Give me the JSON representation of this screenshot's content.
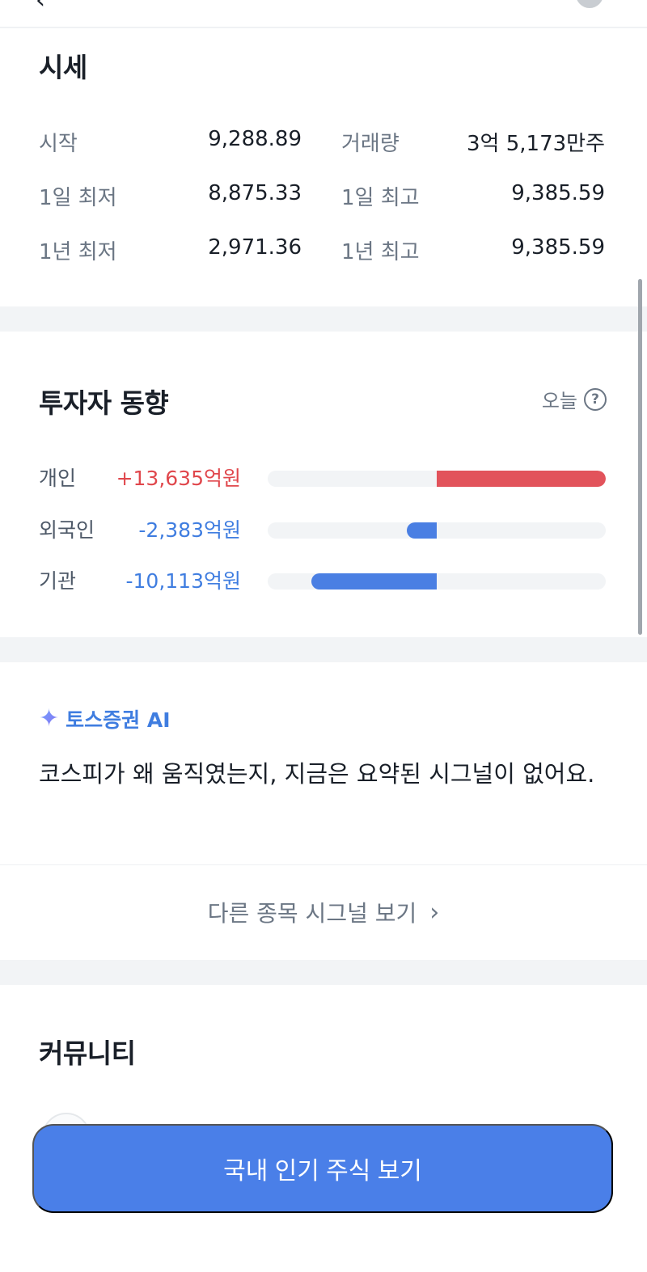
{
  "price": {
    "title": "시세",
    "rows": [
      {
        "label": "시작",
        "value": "9,288.89",
        "label2": "거래량",
        "value2": "3억 5,173만주"
      },
      {
        "label": "1일 최저",
        "value": "8,875.33",
        "label2": "1일 최고",
        "value2": "9,385.59"
      },
      {
        "label": "1년 최저",
        "value": "2,971.36",
        "label2": "1년 최고",
        "value2": "9,385.59"
      }
    ]
  },
  "investor": {
    "title": "투자자 동향",
    "period": "오늘",
    "help_icon": "question-circle-icon",
    "rows": [
      {
        "name": "개인",
        "amount": "+13,635억원",
        "value": 13635,
        "color": "#e2535b"
      },
      {
        "name": "외국인",
        "amount": "-2,383억원",
        "value": -2383,
        "color": "#4a7fe3"
      },
      {
        "name": "기관",
        "amount": "-10,113억원",
        "value": -10113,
        "color": "#4a7fe3"
      }
    ]
  },
  "ai": {
    "icon": "sparkle-icon",
    "label": "토스증권 AI",
    "message": "코스피가 왜 움직였는지, 지금은 요약된 시그널이 없어요.",
    "more_link": "다른 종목 시그널 보기"
  },
  "community": {
    "title": "커뮤니티"
  },
  "cta": {
    "label": "국내 인기 주식 보기"
  },
  "colors": {
    "accent": "#4a7fe8",
    "positive": "#e0474c",
    "negative": "#3f7de0"
  }
}
